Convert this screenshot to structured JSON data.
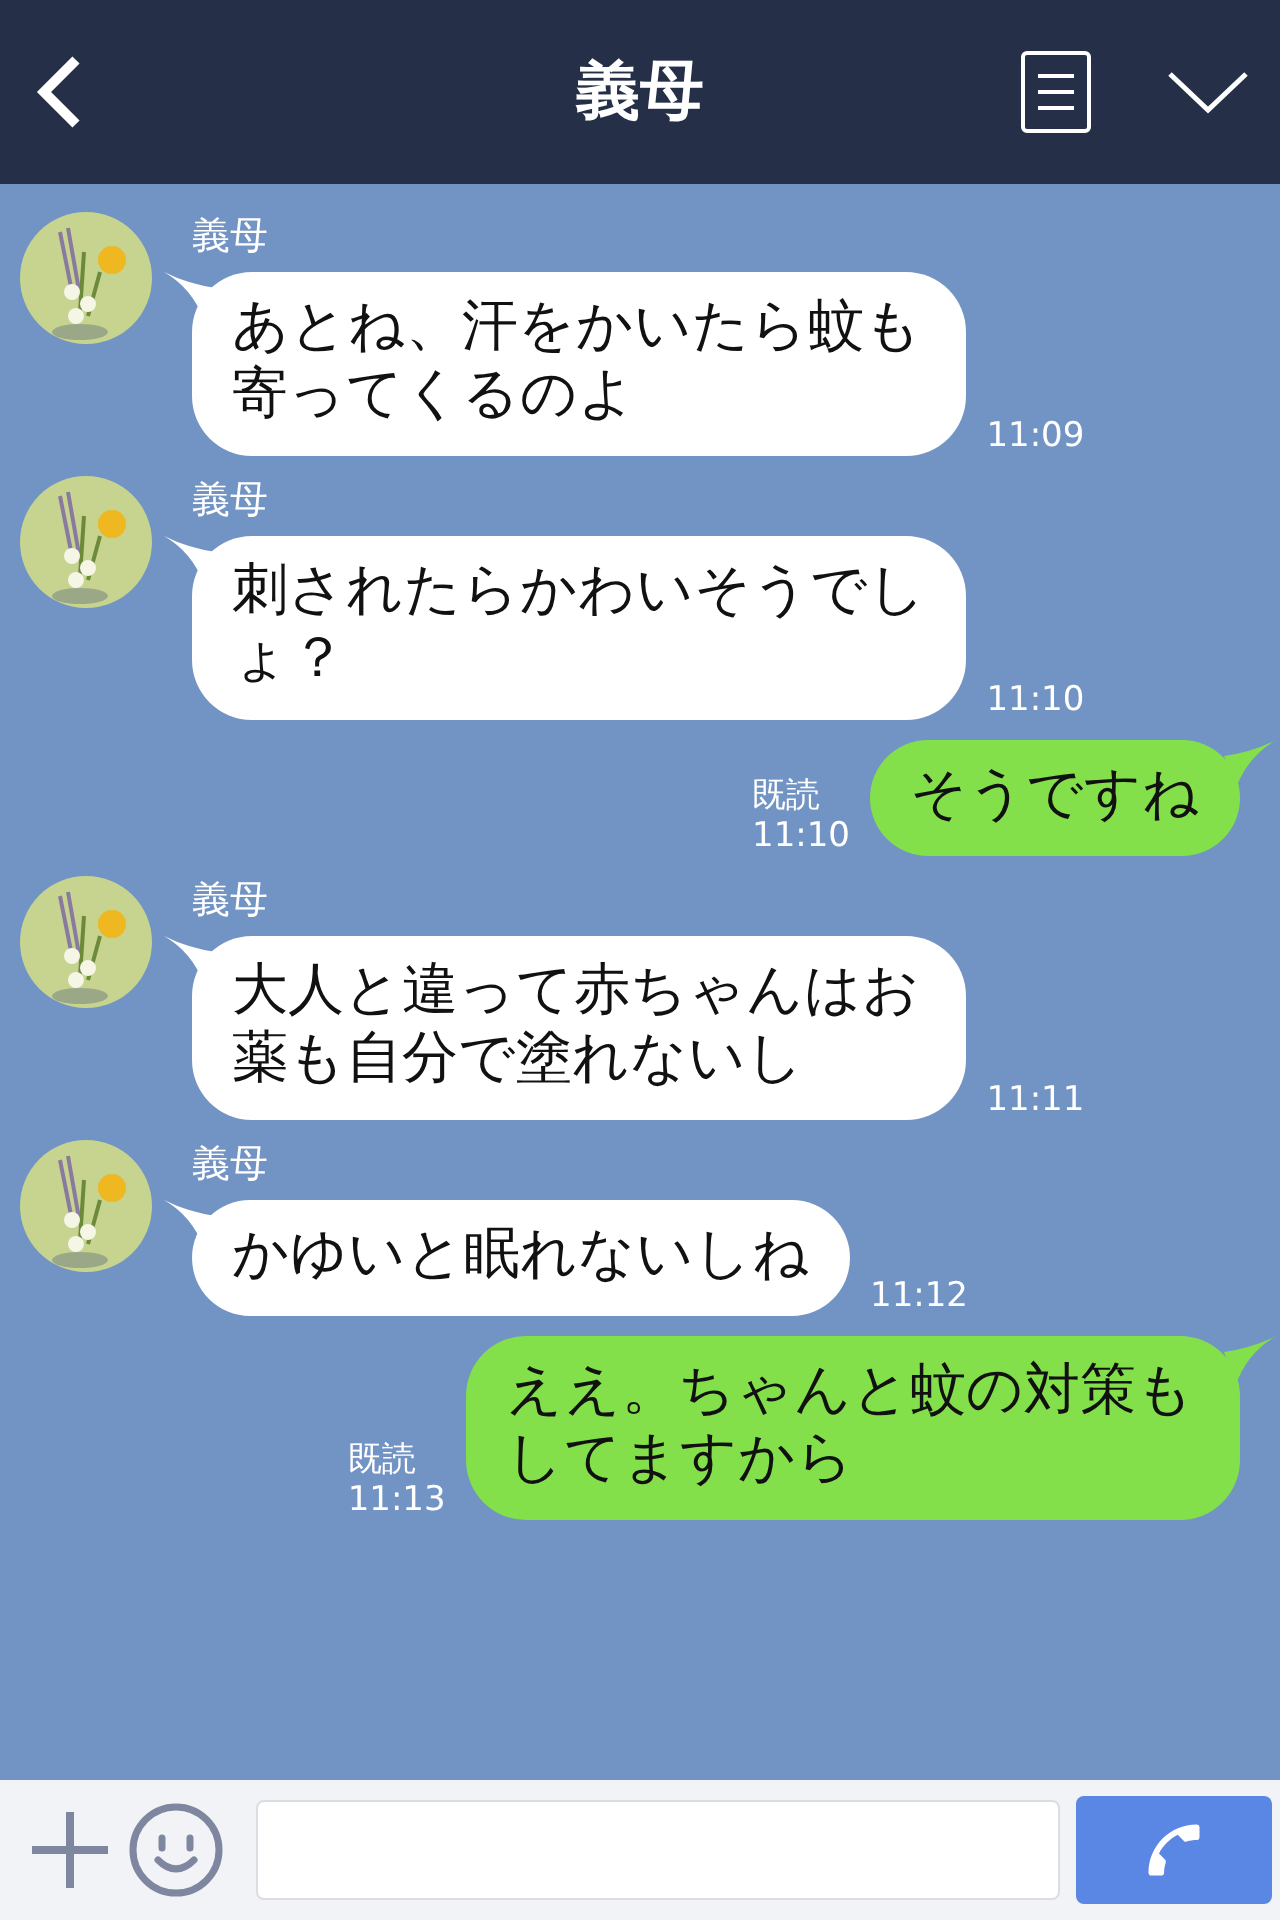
{
  "header": {
    "title": "義母"
  },
  "messages": [
    {
      "kind": "incoming",
      "sender": "義母",
      "text": "あとね、汗をかいたら蚊も寄ってくるのよ",
      "time": "11:09"
    },
    {
      "kind": "incoming",
      "sender": "義母",
      "text": "刺されたらかわいそうでしょ？",
      "time": "11:10"
    },
    {
      "kind": "outgoing",
      "read": "既読",
      "text": "そうですね",
      "time": "11:10"
    },
    {
      "kind": "incoming",
      "sender": "義母",
      "text": "大人と違って赤ちゃんはお薬も自分で塗れないし",
      "time": "11:11"
    },
    {
      "kind": "incoming",
      "sender": "義母",
      "text": "かゆいと眠れないしね",
      "time": "11:12"
    },
    {
      "kind": "outgoing",
      "read": "既読",
      "text": "ええ。ちゃんと蚊の対策もしてますから",
      "time": "11:13"
    }
  ]
}
